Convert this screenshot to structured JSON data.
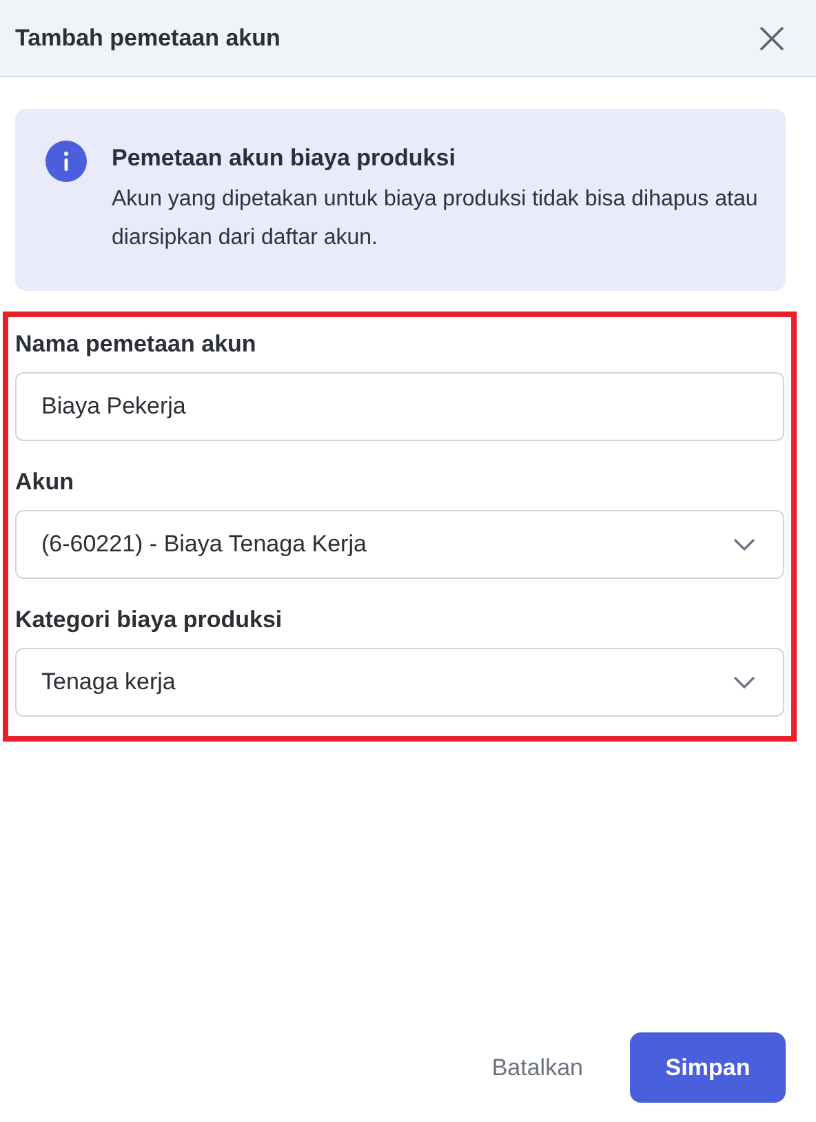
{
  "dialog": {
    "title": "Tambah pemetaan akun"
  },
  "info": {
    "title": "Pemetaan akun biaya produksi",
    "text": "Akun yang dipetakan untuk biaya produksi tidak bisa dihapus atau diarsipkan dari daftar akun."
  },
  "fields": [
    {
      "label": "Nama pemetaan akun",
      "kind": "text",
      "value": "Biaya Pekerja"
    },
    {
      "label": "Akun",
      "kind": "select",
      "value": "(6-60221) - Biaya Tenaga Kerja"
    },
    {
      "label": "Kategori biaya produksi",
      "kind": "select",
      "value": "Tenaga kerja"
    }
  ],
  "buttons": {
    "cancel": "Batalkan",
    "save": "Simpan"
  }
}
